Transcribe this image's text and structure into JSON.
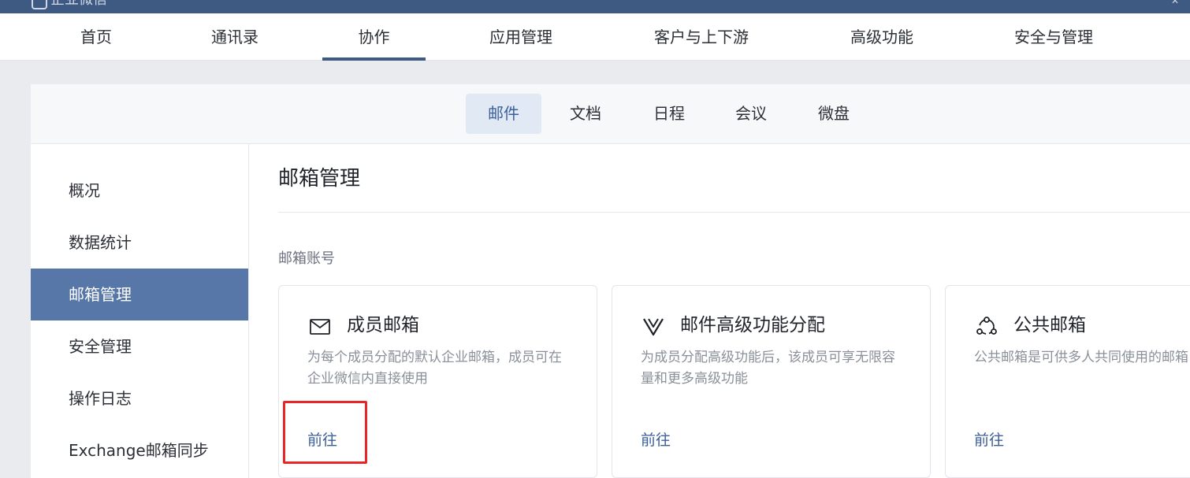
{
  "app": {
    "logo_icon": "chat-logo-icon",
    "title": "企业微信",
    "corner_icon": "window-control-icon"
  },
  "main_nav": {
    "items": [
      {
        "label": "首页"
      },
      {
        "label": "通讯录"
      },
      {
        "label": "协作",
        "active": true
      },
      {
        "label": "应用管理"
      },
      {
        "label": "客户与上下游"
      },
      {
        "label": "高级功能"
      },
      {
        "label": "安全与管理"
      }
    ]
  },
  "sub_nav": {
    "tabs": [
      {
        "label": "邮件",
        "active": true
      },
      {
        "label": "文档"
      },
      {
        "label": "日程"
      },
      {
        "label": "会议"
      },
      {
        "label": "微盘"
      }
    ]
  },
  "sidebar": {
    "items": [
      {
        "label": "概况"
      },
      {
        "label": "数据统计"
      },
      {
        "label": "邮箱管理",
        "active": true
      },
      {
        "label": "安全管理"
      },
      {
        "label": "操作日志"
      },
      {
        "label": "Exchange邮箱同步"
      }
    ]
  },
  "main": {
    "title": "邮箱管理",
    "section_label": "邮箱账号",
    "cards": [
      {
        "icon": "mail-envelope-icon",
        "title": "成员邮箱",
        "desc": "为每个成员分配的默认企业邮箱，成员可在企业微信内直接使用",
        "link": "前往"
      },
      {
        "icon": "premium-v-icon",
        "title": "邮件高级功能分配",
        "desc": "为成员分配高级功能后，该成员可享无限容量和更多高级功能",
        "link": "前往"
      },
      {
        "icon": "shared-group-icon",
        "title": "公共邮箱",
        "desc": "公共邮箱是可供多人共同使用的邮箱",
        "link": "前往"
      }
    ]
  },
  "colors": {
    "header_bar": "#3f5a82",
    "accent": "#3b5f9a",
    "sidebar_active": "#5777a8",
    "highlight": "#e8262a"
  }
}
